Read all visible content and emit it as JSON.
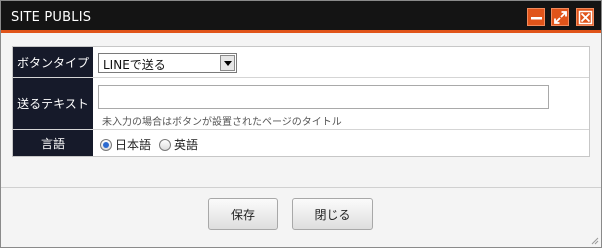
{
  "window": {
    "title": "SITE PUBLIS",
    "controls": [
      {
        "icon": "minimize-icon"
      },
      {
        "icon": "maximize-icon"
      },
      {
        "icon": "close-icon"
      }
    ]
  },
  "form": {
    "button_type": {
      "label": "ボタンタイプ",
      "selected": "LINEで送る"
    },
    "send_text": {
      "label": "送るテキスト",
      "value": "",
      "hint": "未入力の場合はボタンが設置されたページのタイトル"
    },
    "language": {
      "label": "言語",
      "options": [
        {
          "label": "日本語",
          "checked": true
        },
        {
          "label": "英語",
          "checked": false
        }
      ]
    }
  },
  "buttons": {
    "save": "保存",
    "close": "閉じる"
  },
  "colors": {
    "accent": "#e0541a",
    "titlebar": "#141414",
    "label_bg": "#161a2a"
  }
}
